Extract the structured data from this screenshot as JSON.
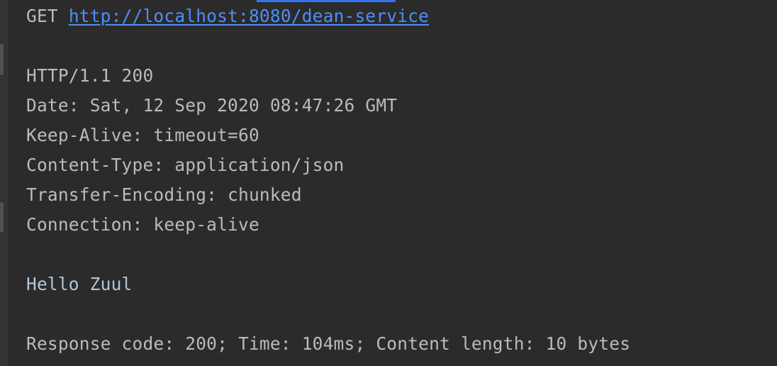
{
  "request": {
    "method": "GET",
    "url": "http://localhost:8080/dean-service"
  },
  "response": {
    "status_line": "HTTP/1.1 200",
    "headers": [
      "Date: Sat, 12 Sep 2020 08:47:26 GMT",
      "Keep-Alive: timeout=60",
      "Content-Type: application/json",
      "Transfer-Encoding: chunked",
      "Connection: keep-alive"
    ],
    "body": "Hello Zuul",
    "summary": "Response code: 200; Time: 104ms; Content length: 10 bytes"
  },
  "colors": {
    "background": "#2b2b2b",
    "text": "#b7bcc1",
    "link": "#4f8ef7",
    "body_text": "#b3c6dc",
    "accent": "#3574f0"
  }
}
